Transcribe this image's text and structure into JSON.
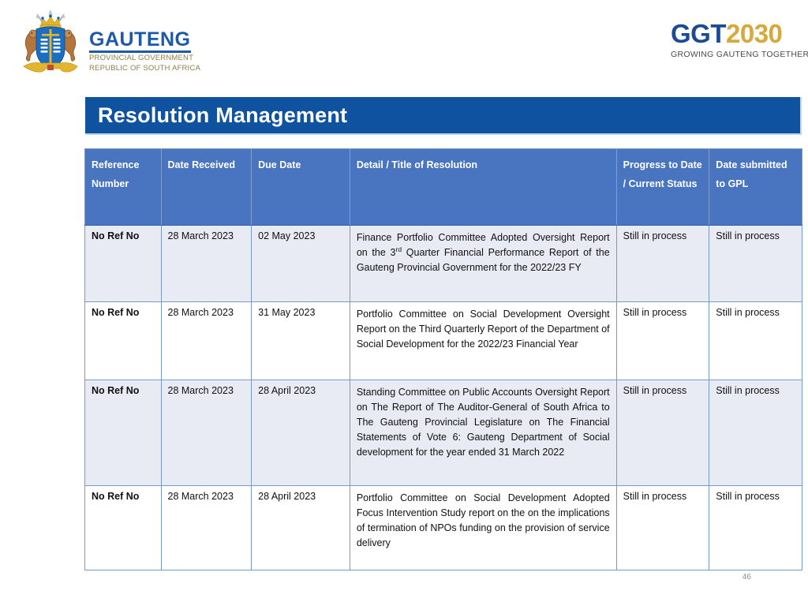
{
  "header": {
    "coat_of_arms_alt": "gauteng-coat-of-arms",
    "wordmark": {
      "name": "GAUTENG",
      "line1": "PROVINCIAL GOVERNMENT",
      "line2": "REPUBLIC OF SOUTH AFRICA"
    },
    "ggt_logo": {
      "prefix": "GGT",
      "year": "2030",
      "tagline": "GROWING GAUTENG TOGETHER"
    }
  },
  "title": "Resolution Management",
  "table": {
    "headers": [
      "Reference Number",
      "Date Received",
      "Due Date",
      "Detail / Title of Resolution",
      "Progress to Date / Current Status",
      "Date submitted to GPL"
    ],
    "rows": [
      {
        "reference_number": "No Ref No",
        "date_received": "28 March 2023",
        "due_date": "02 May 2023",
        "detail_prefix": "Finance Portfolio Committee Adopted Oversight Report on the 3",
        "detail_sup": "rd",
        "detail_suffix": " Quarter Financial Performance Report of the Gauteng Provincial Government for the 2022/23 FY",
        "detail": "Finance Portfolio Committee Adopted Oversight Report on the 3rd Quarter Financial Performance Report of the Gauteng Provincial Government for the 2022/23 FY",
        "progress_to_date": "Still in process",
        "date_submitted_to_gpl": "Still in process"
      },
      {
        "reference_number": "No Ref No",
        "date_received": "28 March 2023",
        "due_date": "31 May 2023",
        "detail": "Portfolio Committee on Social Development Oversight Report on the Third Quarterly Report of the Department of Social Development for the 2022/23 Financial Year",
        "progress_to_date": "Still in process",
        "date_submitted_to_gpl": "Still in process"
      },
      {
        "reference_number": "No Ref No",
        "date_received": "28 March 2023",
        "due_date": "28 April 2023",
        "detail": "Standing Committee on Public Accounts Oversight Report on The Report of The Auditor-General of South Africa to The Gauteng Provincial Legislature on The Financial Statements of Vote 6: Gauteng Department of Social development for the year ended 31 March 2022",
        "progress_to_date": "Still in process",
        "date_submitted_to_gpl": "Still in process"
      },
      {
        "reference_number": "No Ref No",
        "date_received": "28 March 2023",
        "due_date": "28 April 2023",
        "detail": "Portfolio Committee on Social Development Adopted Focus Intervention Study report on the on the implications of termination of NPOs funding on the provision of service delivery",
        "progress_to_date": "Still in process",
        "date_submitted_to_gpl": "Still in process"
      }
    ]
  },
  "page_number": "46",
  "colors": {
    "title_bar": "#0f52a0",
    "table_header": "#4874c0",
    "row_alt": "#e8eaf4",
    "brand_blue": "#1c5aa8",
    "brand_gold": "#d6a93a"
  }
}
